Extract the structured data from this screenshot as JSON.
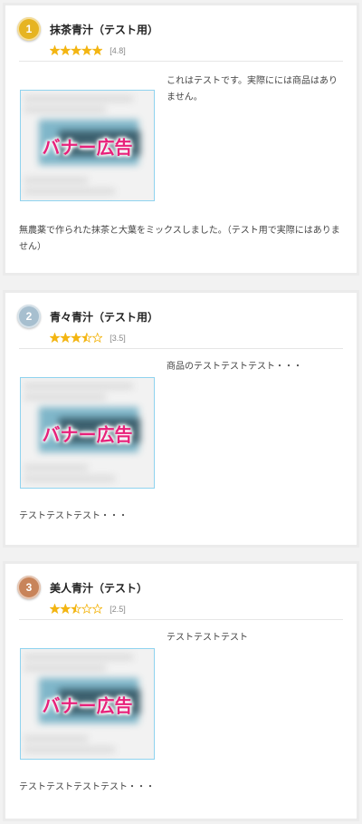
{
  "items": [
    {
      "rank": "1",
      "badge_color": "#e6b422",
      "title": "抹茶青汁（テスト用）",
      "rating": 4.8,
      "score_label": "[4.8]",
      "banner_label": "バナー広告",
      "side_text": "これはテストです。実際にには商品はありません。",
      "description": "無農薬で作られた抹茶と大葉をミックスしました。（テスト用で実際にはありません）"
    },
    {
      "rank": "2",
      "badge_color": "#a7bfcf",
      "title": "青々青汁（テスト用）",
      "rating": 3.5,
      "score_label": "[3.5]",
      "banner_label": "バナー広告",
      "side_text": "商品のテストテストテスト・・・",
      "description": "テストテストテスト・・・"
    },
    {
      "rank": "3",
      "badge_color": "#c8845a",
      "title": "美人青汁（テスト）",
      "rating": 2.5,
      "score_label": "[2.5]",
      "banner_label": "バナー広告",
      "side_text": "テストテストテスト",
      "description": "テストテストテストテスト・・・"
    }
  ],
  "colors": {
    "star_filled": "#f3b512",
    "star_empty": "#f3b512",
    "banner_text": "#e8217a",
    "banner_border": "#8fd3ef"
  },
  "icons": {
    "star": "star-icon",
    "rank": "rank-medal-icon"
  }
}
